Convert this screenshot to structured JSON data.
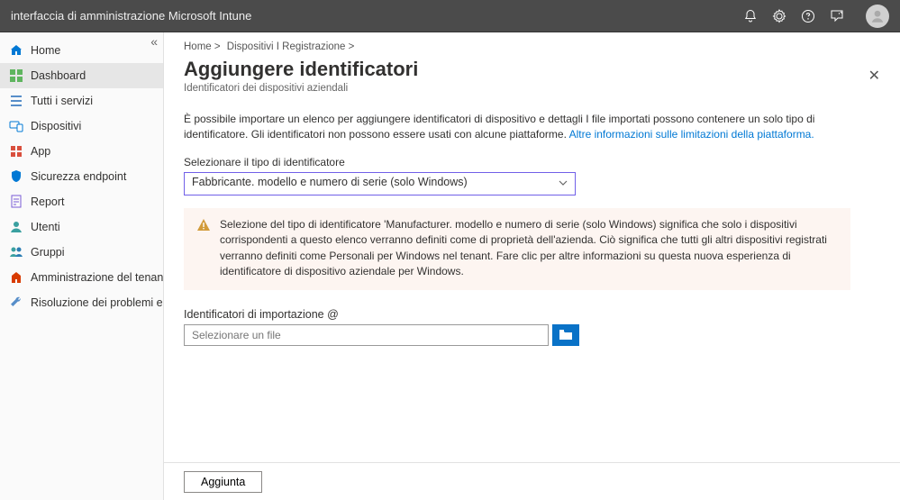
{
  "topbar": {
    "title": "interfaccia di amministrazione Microsoft Intune"
  },
  "sidebar": {
    "items": [
      {
        "label": "Home"
      },
      {
        "label": "Dashboard"
      },
      {
        "label": "Tutti i servizi"
      },
      {
        "label": "Dispositivi"
      },
      {
        "label": "App"
      },
      {
        "label": "Sicurezza endpoint"
      },
      {
        "label": "Report"
      },
      {
        "label": "Utenti"
      },
      {
        "label": "Gruppi"
      },
      {
        "label": "Amministrazione del tenant"
      },
      {
        "label": "Risoluzione dei problemi e supporto"
      }
    ]
  },
  "breadcrumb": {
    "a": "Home >",
    "b": "Dispositivi I Registrazione >"
  },
  "page": {
    "title": "Aggiungere identificatori",
    "subtitle": "Identificatori dei dispositivi aziendali",
    "desc_main": "È possibile importare un elenco per aggiungere identificatori di dispositivo e dettagli I file importati possono contenere un solo tipo di identificatore. Gli identificatori non possono essere usati con alcune piattaforme. ",
    "desc_link": "Altre informazioni sulle limitazioni della piattaforma.",
    "select_label": "Selezionare il tipo di identificatore",
    "select_value": "Fabbricante. modello e numero di serie (solo Windows)",
    "warning": "Selezione del tipo di identificatore 'Manufacturer. modello e numero di serie (solo Windows) significa che solo i dispositivi corrispondenti a questo elenco verranno definiti come di proprietà dell'azienda. Ciò significa che tutti gli altri dispositivi registrati verranno definiti come Personali per Windows nel tenant. Fare clic per altre informazioni su questa nuova esperienza di identificatore di dispositivo aziendale per Windows.",
    "import_label": "Identificatori di importazione @",
    "import_placeholder": "Selezionare un file",
    "add_button": "Aggiunta"
  }
}
